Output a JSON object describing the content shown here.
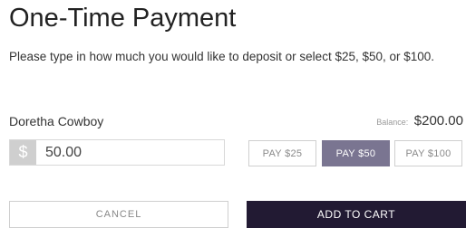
{
  "header": {
    "title": "One-Time Payment",
    "subtitle": "Please type in how much you would like to deposit or select $25, $50, or $100."
  },
  "account": {
    "name": "Doretha Cowboy",
    "balance_label": "Balance:",
    "balance_value": "$200.00"
  },
  "amount": {
    "currency_symbol": "$",
    "value": "50.00"
  },
  "quick_pay": {
    "options": [
      {
        "label": "PAY $25",
        "selected": false
      },
      {
        "label": "PAY $50",
        "selected": true
      },
      {
        "label": "PAY $100",
        "selected": false
      }
    ]
  },
  "actions": {
    "cancel_label": "CANCEL",
    "add_to_cart_label": "ADD TO CART"
  },
  "colors": {
    "selected_pay_button": "#7a7591",
    "add_to_cart_button": "#221a33",
    "currency_addon": "#cfcfcf"
  }
}
